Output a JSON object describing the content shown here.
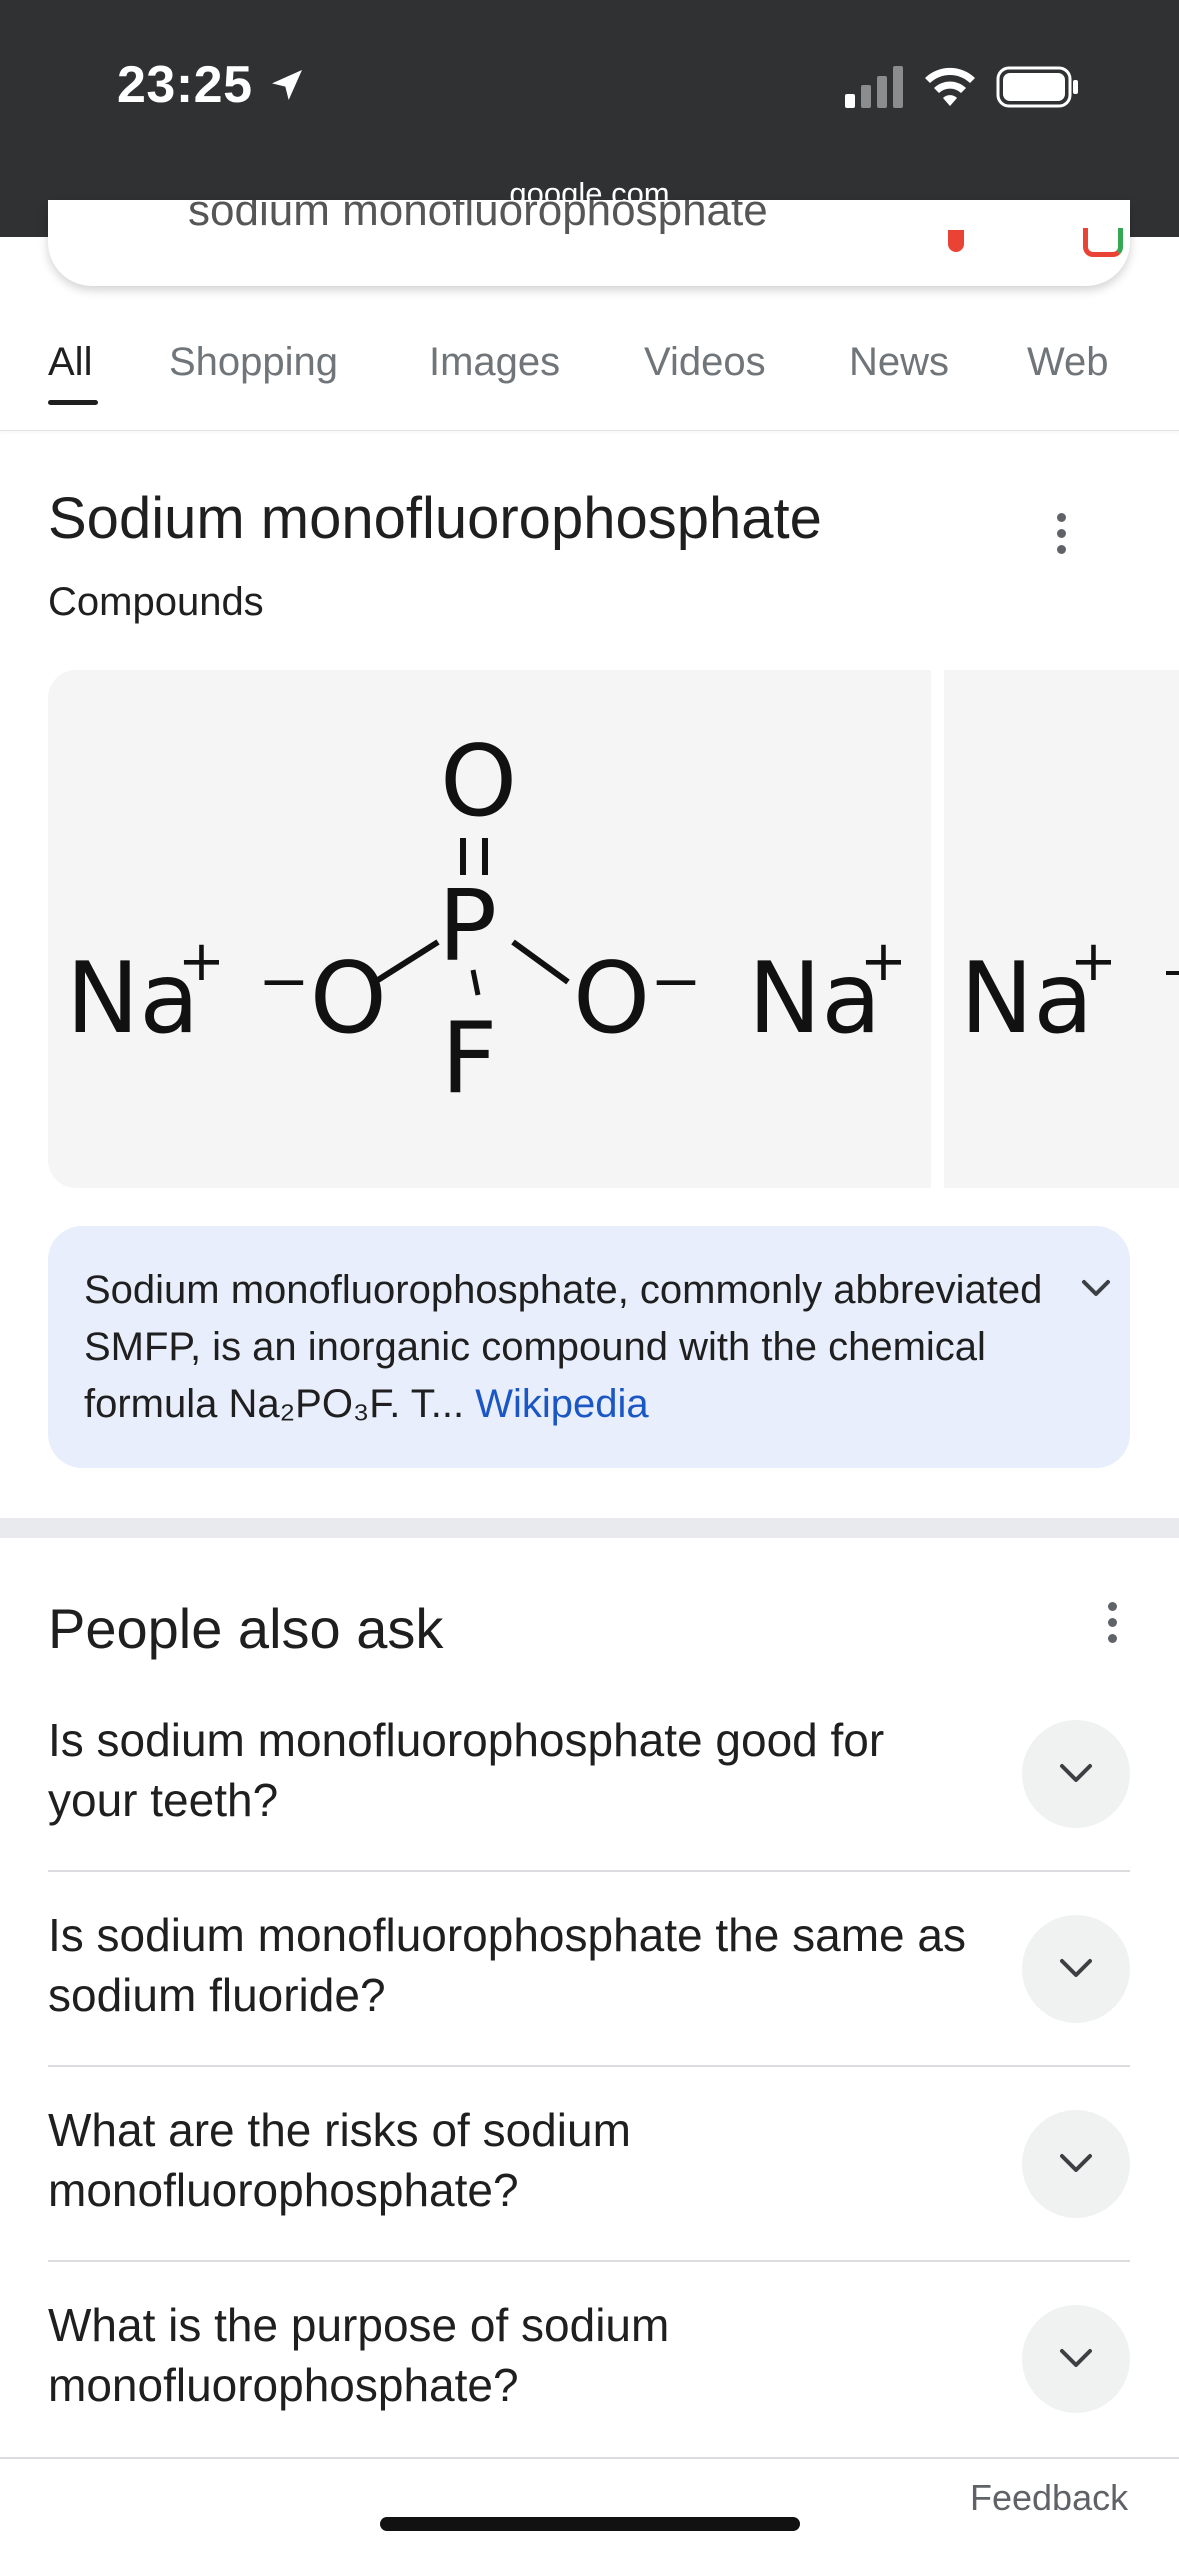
{
  "status_bar": {
    "time": "23:25",
    "url": "google.com"
  },
  "search": {
    "query": "sodium monofluorophosphate"
  },
  "tabs": [
    {
      "label": "All",
      "active": true
    },
    {
      "label": "Shopping",
      "active": false
    },
    {
      "label": "Images",
      "active": false
    },
    {
      "label": "Videos",
      "active": false
    },
    {
      "label": "News",
      "active": false
    },
    {
      "label": "Web",
      "active": false
    }
  ],
  "knowledge_panel": {
    "title": "Sodium monofluorophosphate",
    "subtitle": "Compounds",
    "structure": {
      "na1": "Na",
      "plus": "+",
      "o_left": "⁻O",
      "p": "P",
      "o_top": "O",
      "f": "F",
      "o_right": "O⁻",
      "na2": "Na",
      "na3": "Na"
    },
    "description_prefix": "Sodium monofluorophosphate, commonly abbreviated SMFP, is an inorganic compound with the chemical formula Na₂PO₃F. T...",
    "description_link": "Wikipedia"
  },
  "people_also_ask": {
    "title": "People also ask",
    "questions": [
      "Is sodium monofluorophosphate good for your teeth?",
      "Is sodium monofluorophosphate the same as sodium fluoride?",
      "What are the risks of sodium monofluorophosphate?",
      "What is the purpose of sodium monofluorophosphate?"
    ]
  },
  "footer": {
    "feedback": "Feedback"
  },
  "colors": {
    "status_bar": "#2f3133",
    "link": "#1a56c4",
    "description_bg": "#e8eefb"
  }
}
